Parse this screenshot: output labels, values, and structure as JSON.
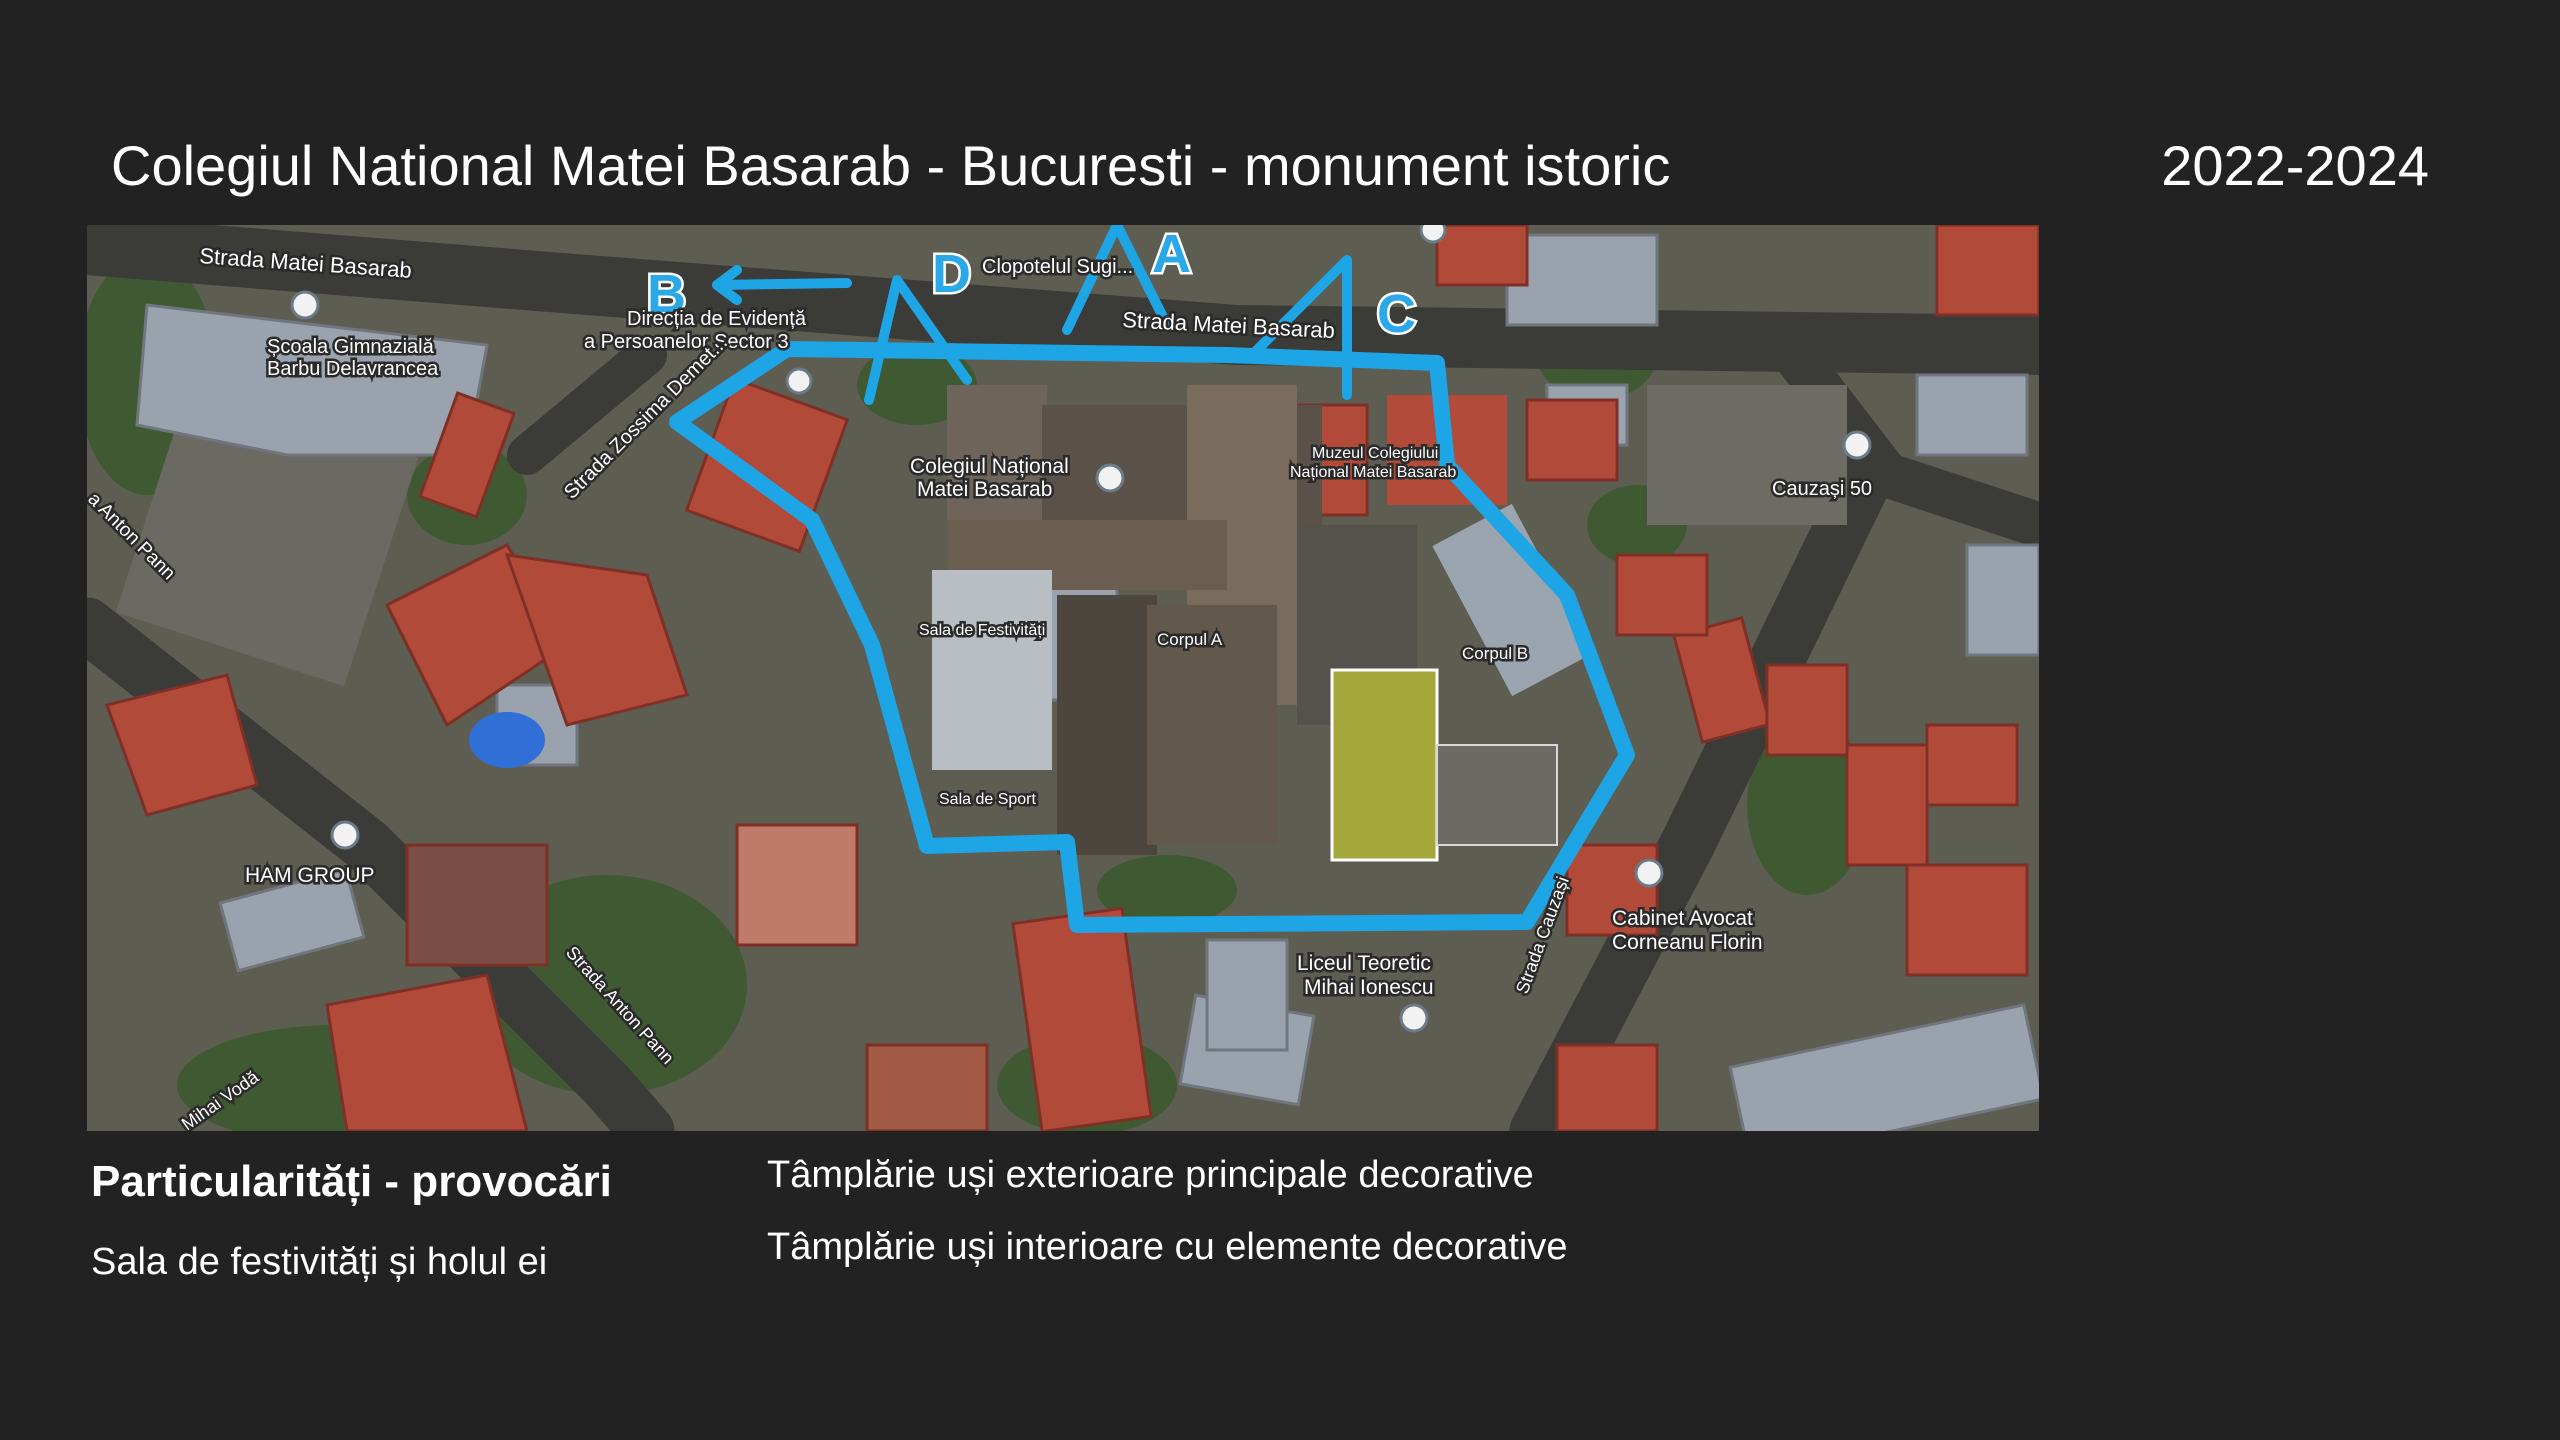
{
  "slide": {
    "title": "Colegiul National Matei Basarab - Bucuresti - monument istoric",
    "years": "2022-2024"
  },
  "map": {
    "outline_color": "#1ea5e6",
    "labels": {
      "strada_matei_basarab_left": "Strada Matei Basarab",
      "strada_matei_basarab_top": "Strada Matei Basarab",
      "clopotelul": "Clopotelul Sugi...",
      "directia_evidenta": "Direcția de Evidență",
      "persoanelor_sector": "a Persoanelor Sector 3",
      "strada_zossima": "Strada Zossima Demet...",
      "scoala_line1": "Școala Gimnazială",
      "scoala_line2": "Barbu Delavrancea",
      "colegiul_line1": "Colegiul Național",
      "colegiul_line2": "Matei Basarab",
      "muzeul_line1": "Muzeul Colegiului",
      "muzeul_line2": "Național Matei Basarab",
      "cauzasi_50": "Cauzași 50",
      "anton_pann_left": "a Anton Pann",
      "sala_festivitati": "Sala de Festivități",
      "corpul_a": "Corpul A",
      "corpul_b": "Corpul B",
      "sala_sport": "Sala de Sport",
      "ham_group": "HAM GROUP",
      "strada_anton_pann": "Strada Anton Pann",
      "cabinet_line1": "Cabinet Avocat",
      "cabinet_line2": "Corneanu Florin",
      "liceul_line1": "Liceul Teoretic",
      "liceul_line2": "Mihai Ionescu",
      "strada_cauzasi": "Strada Cauzași",
      "mihai_voda": "Mihai Vodă"
    },
    "markers": {
      "a": "A",
      "b": "B",
      "c": "C",
      "d": "D"
    }
  },
  "section": {
    "title": "Particularități - provocări",
    "left_items": [
      "Sala de festivități și holul ei"
    ],
    "right_items": [
      "Tâmplărie uși exterioare principale decorative",
      "Tâmplărie uși interioare cu elemente decorative"
    ]
  }
}
